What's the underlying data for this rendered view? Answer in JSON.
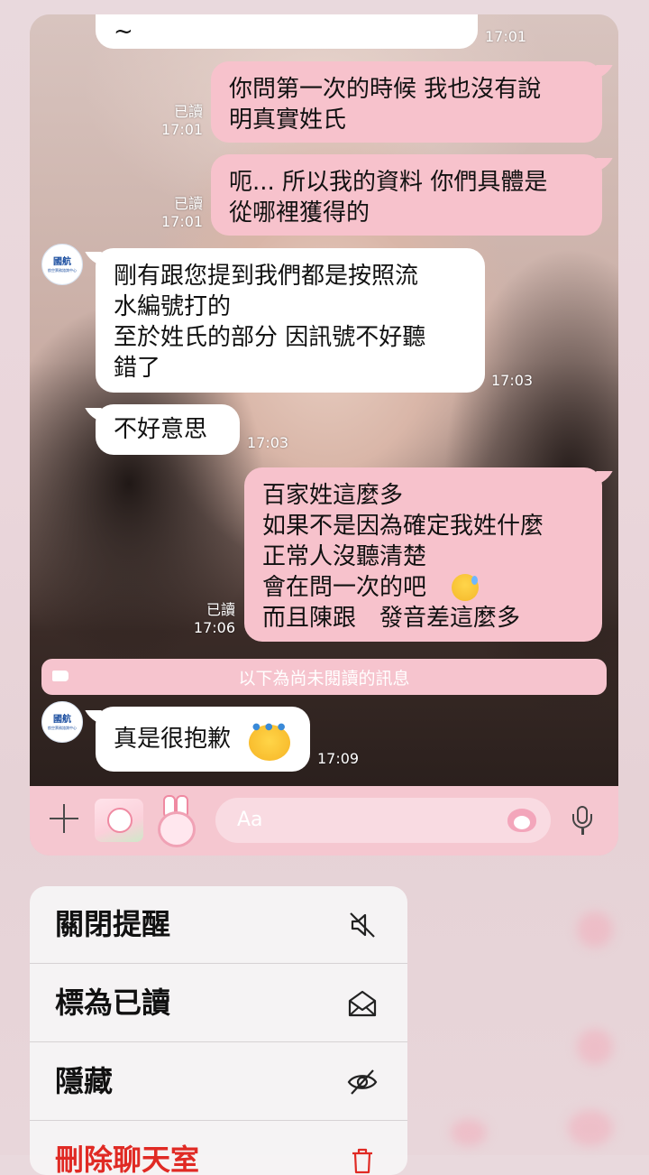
{
  "chat": {
    "top_message": {
      "text": "~",
      "time": "17:01"
    },
    "messages": [
      {
        "side": "out",
        "text": "你問第一次的時候 我也沒有說\n明真實姓氏",
        "read": "已讀",
        "time": "17:01"
      },
      {
        "side": "out",
        "text": "呃... 所以我的資料 你們具體是\n從哪裡獲得的",
        "read": "已讀",
        "time": "17:01"
      },
      {
        "side": "in",
        "text": "剛有跟您提到我們都是按照流\n水編號打的\n至於姓氏的部分 因訊號不好聽\n錯了",
        "time": "17:03"
      },
      {
        "side": "in",
        "text": "不好意思",
        "time": "17:03"
      },
      {
        "side": "out",
        "text": "百家姓這麼多\n如果不是因為確定我姓什麼\n正常人沒聽清楚\n會在問一次的吧\n而且陳跟　發音差這麼多",
        "read": "已讀",
        "time": "17:06"
      },
      {
        "side": "in",
        "text": "真是很抱歉",
        "time": "17:09"
      }
    ],
    "avatar_label": "國航",
    "avatar_sublabel": "航空票務諮詢中心",
    "unread_divider": "以下為尚未閱讀的訊息",
    "input_placeholder": "Aa"
  },
  "menu": {
    "items": [
      {
        "label": "關閉提醒",
        "icon": "mute-icon"
      },
      {
        "label": "標為已讀",
        "icon": "envelope-open-icon"
      },
      {
        "label": "隱藏",
        "icon": "eye-slash-icon"
      },
      {
        "label": "刪除聊天室",
        "icon": "trash-icon",
        "color": "#e02a24"
      }
    ]
  },
  "colors": {
    "outgoing_bubble": "#f7c2cc",
    "input_bar": "#f5c7d0",
    "danger": "#e02a24"
  }
}
